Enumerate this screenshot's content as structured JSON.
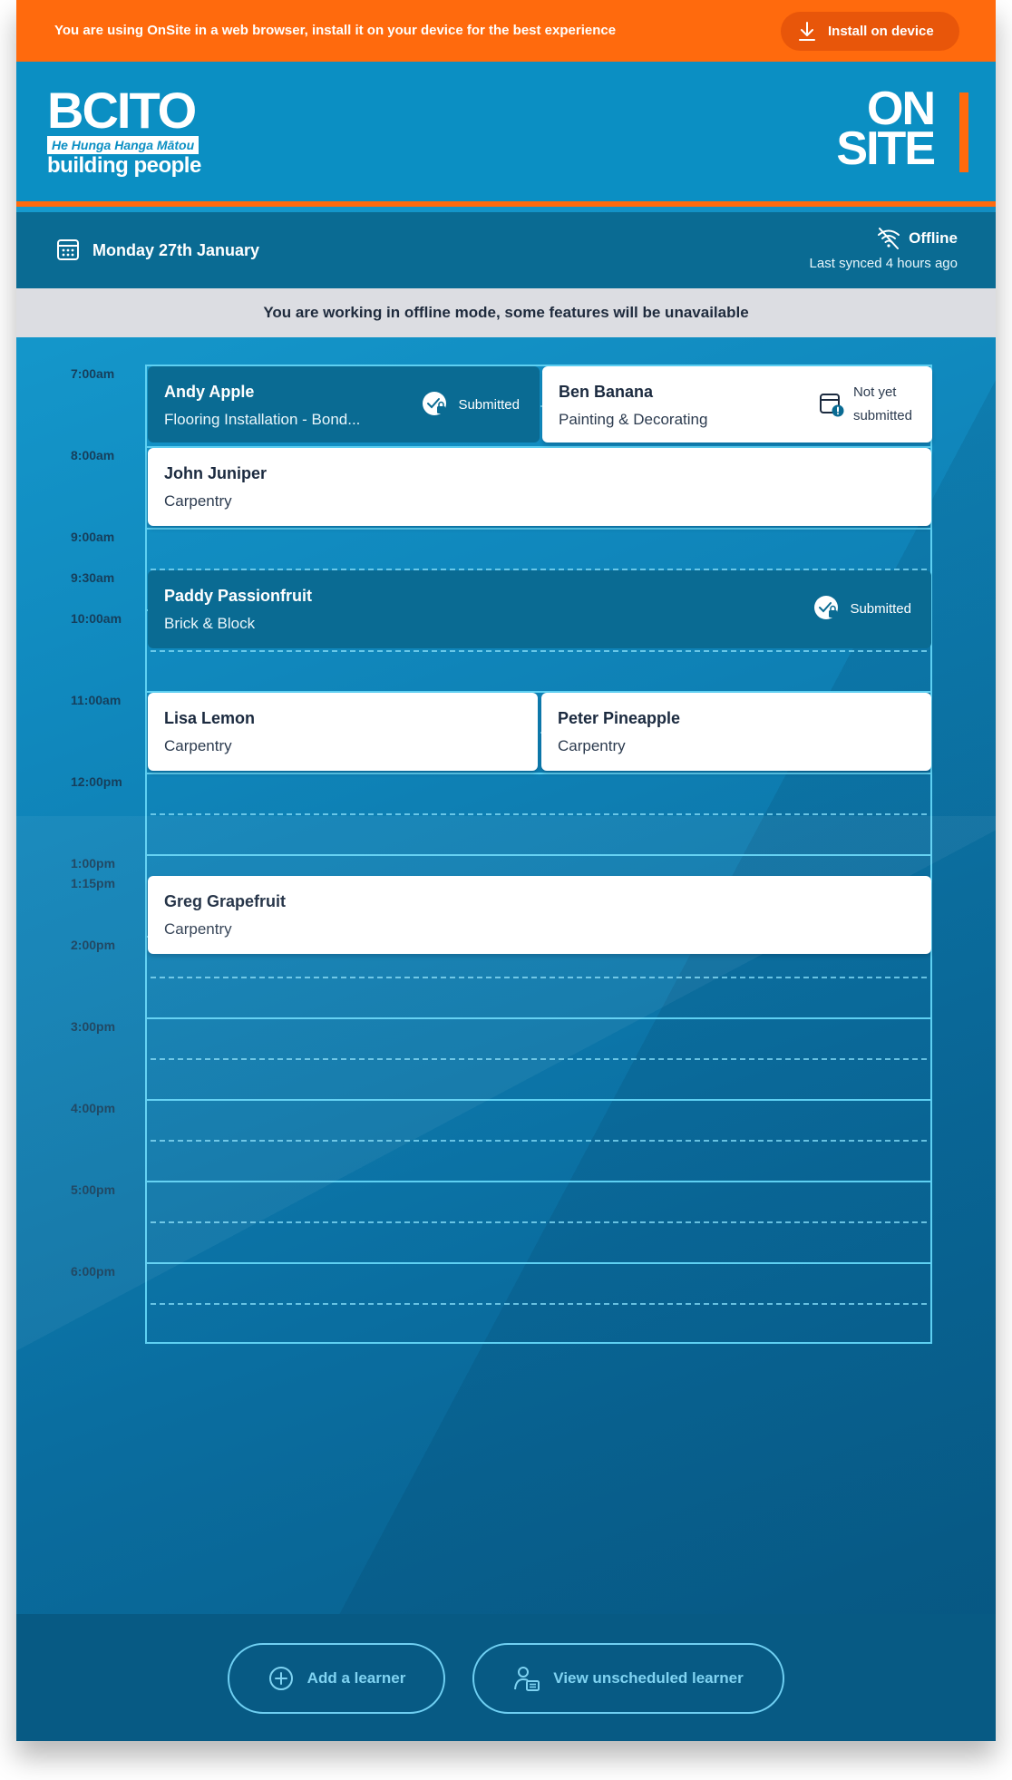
{
  "install_banner": {
    "message": "You are using OnSite in a web browser, install it on your device for the best experience",
    "button_label": "Install on device"
  },
  "header": {
    "org_logo": {
      "word": "BCITO",
      "tagline": "He Hunga Hanga Mātou",
      "subline": "building people"
    },
    "app_logo": {
      "line1": "ON",
      "line2": "SITE"
    }
  },
  "date_bar": {
    "date": "Monday 27th January",
    "connection_status": "Offline",
    "last_synced": "Last synced 4 hours ago"
  },
  "offline_notice": "You are working in offline mode, some features will be unavailable",
  "timeline": {
    "times": [
      "7:00am",
      "8:00am",
      "9:00am",
      "9:30am",
      "10:00am",
      "11:00am",
      "12:00pm",
      "1:00pm",
      "1:15pm",
      "2:00pm",
      "3:00pm",
      "4:00pm",
      "5:00pm",
      "6:00pm"
    ],
    "appointments": [
      {
        "name": "Andy Apple",
        "trade": "Flooring Installation - Bond...",
        "status": "Submitted"
      },
      {
        "name": "Ben Banana",
        "trade": "Painting & Decorating",
        "status_line1": "Not yet",
        "status_line2": "submitted"
      },
      {
        "name": "John Juniper",
        "trade": "Carpentry"
      },
      {
        "name": "Paddy Passionfruit",
        "trade": "Brick & Block",
        "status": "Submitted"
      },
      {
        "name": "Lisa Lemon",
        "trade": "Carpentry"
      },
      {
        "name": "Peter Pineapple",
        "trade": "Carpentry"
      },
      {
        "name": "Greg Grapefruit",
        "trade": "Carpentry"
      }
    ]
  },
  "footer": {
    "add_learner": "Add a learner",
    "view_unscheduled": "View unscheduled learner"
  },
  "colors": {
    "accent_orange": "#ff6a0d",
    "header_blue": "#0b8fc3",
    "dark_blue": "#0a6b93",
    "grid_line": "#5ed0f2"
  },
  "icons": [
    "download-icon",
    "calendar-icon",
    "wifi-off-icon",
    "submitted-lock-icon",
    "not-submitted-icon",
    "plus-circle-icon",
    "learner-list-icon"
  ]
}
